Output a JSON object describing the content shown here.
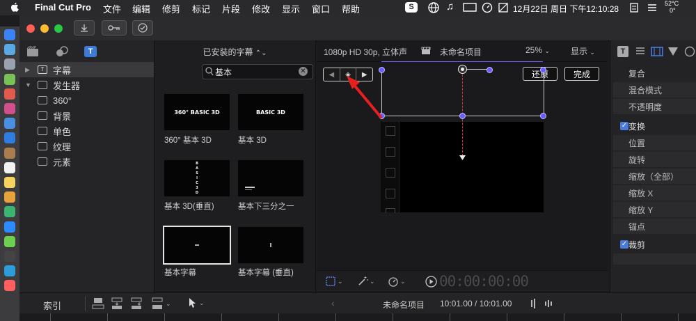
{
  "menubar": {
    "app_name": "Final Cut Pro",
    "menus": [
      "文件",
      "编辑",
      "修剪",
      "标记",
      "片段",
      "修改",
      "显示",
      "窗口",
      "帮助"
    ],
    "clock": "12月22日 周日 下午12:10:28",
    "temp": "52°C",
    "temp2": "0°"
  },
  "dock": {
    "colors": [
      "#3b82f6",
      "#5aa9e6",
      "#9aa3ad",
      "#78c257",
      "#e05b4b",
      "#d0508a",
      "#4a90e2",
      "#2f7de1",
      "#a97d4f",
      "#f2f2f2",
      "#f4d35e",
      "#e8a23c",
      "#3cb371",
      "#2e8bff",
      "#6ccf4f",
      "#444",
      "#2d9cdb",
      "#ff5f5f"
    ]
  },
  "sidebar": {
    "items": [
      {
        "label": "字幕",
        "selected": true
      },
      {
        "label": "发生器",
        "expanded": true
      },
      {
        "label": "360°"
      },
      {
        "label": "背景"
      },
      {
        "label": "单色"
      },
      {
        "label": "纹理"
      },
      {
        "label": "元素"
      }
    ]
  },
  "browser": {
    "header": "已安装的字幕",
    "search_value": "基本",
    "thumbs": [
      {
        "text": "360° BASIC 3D",
        "caption": "360° 基本 3D"
      },
      {
        "text": "BASIC 3D",
        "caption": "基本 3D"
      },
      {
        "text": "BASIC3D",
        "caption": "基本 3D(垂直)"
      },
      {
        "text": "",
        "caption": "基本下三分之一"
      },
      {
        "text": "",
        "caption": "基本字幕"
      },
      {
        "text": "",
        "caption": "基本字幕 (垂直)"
      }
    ]
  },
  "viewer": {
    "format": "1080p HD 30p, 立体声",
    "project": "未命名项目",
    "zoom": "25%",
    "display": "显示",
    "revert": "还原",
    "done": "完成",
    "timecode": "00:00:00:00"
  },
  "inspector": {
    "rows": [
      "复合",
      "混合模式",
      "不透明度"
    ],
    "transform": "变换",
    "transform_rows": [
      "位置",
      "旋转",
      "缩放（全部）",
      "缩放 X",
      "缩放 Y",
      "锚点"
    ],
    "crop": "裁剪"
  },
  "bottombar": {
    "index": "索引",
    "project": "未命名项目",
    "duration": "10:01.00 / 10:01.00"
  }
}
